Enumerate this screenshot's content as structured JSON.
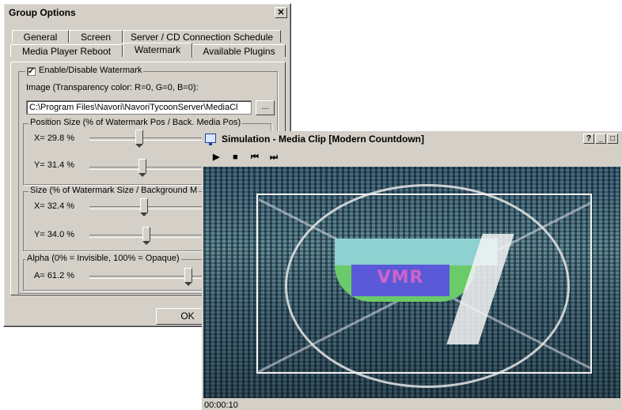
{
  "group_options": {
    "title": "Group Options",
    "close_glyph": "✕",
    "tabs_row1": [
      "General",
      "Screen",
      "Server / CD Connection Schedule"
    ],
    "tabs_row2": [
      "Media Player Reboot",
      "Watermark",
      "Available Plugins"
    ],
    "active_tab": "Watermark",
    "watermark": {
      "enable_label": "Enable/Disable Watermark",
      "enable_checked": true,
      "image_label": "Image (Transparency color: R=0, G=0, B=0):",
      "image_path": "C:\\Program Files\\Navori\\NavoriTycoonServer\\MediaCl",
      "browse_label": "...",
      "position_group": {
        "title": "Position Size (% of Watermark Pos / Back. Media Pos)",
        "x_label": "X= 29.8 %",
        "x_value": 29.8,
        "y_label": "Y= 31.4 %",
        "y_value": 31.4
      },
      "size_group": {
        "title": "Size (% of Watermark Size / Background M",
        "x_label": "X= 32.4 %",
        "x_value": 32.4,
        "y_label": "Y= 34.0 %",
        "y_value": 34.0
      },
      "alpha_group": {
        "title": "Alpha (0% = Invisible, 100% = Opaque)",
        "a_label": "A= 61.2 %",
        "a_value": 61.2
      }
    },
    "ok_label": "OK"
  },
  "simulation": {
    "title": "Simulation - Media Clip [Modern Countdown]",
    "window_buttons": [
      "?",
      "_",
      "□"
    ],
    "controls": {
      "play": "▶",
      "stop": "■",
      "prev": "⏮",
      "next": "⏭"
    },
    "video_logo_text": "VMR",
    "timecode": "00:00:10"
  }
}
